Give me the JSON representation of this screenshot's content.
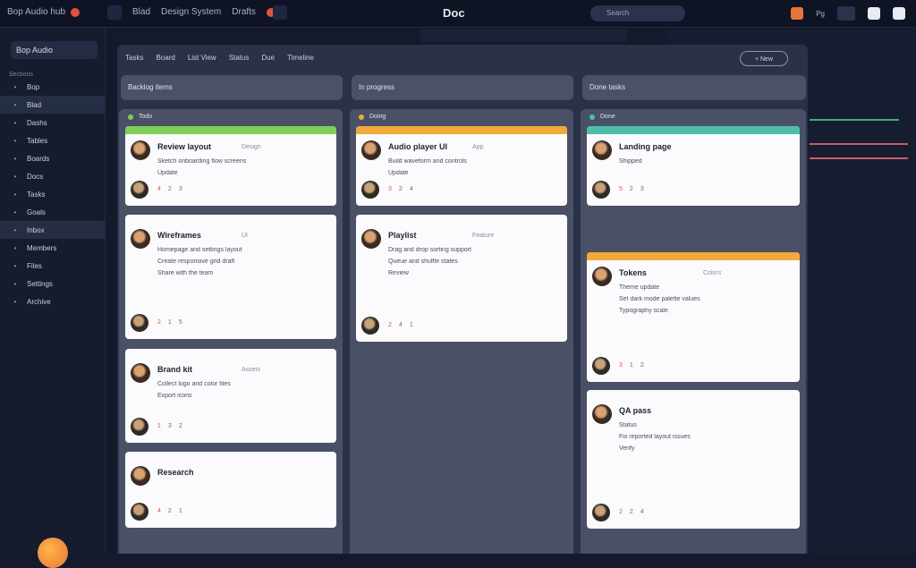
{
  "topbar": {
    "workspace": "Bop Audio hub",
    "crumbs": [
      "Blad",
      "Design System",
      "Drafts"
    ],
    "title": "Doc",
    "search_placeholder": "Search",
    "right_label": "Pg"
  },
  "sidebar": {
    "workspace_name": "Bop Audio",
    "section_label": "Sections",
    "items": [
      {
        "label": "Bop"
      },
      {
        "label": "Blad"
      },
      {
        "label": "Dashs"
      },
      {
        "label": "Tables"
      },
      {
        "label": "Boards"
      },
      {
        "label": "Docs"
      },
      {
        "label": "Tasks"
      },
      {
        "label": "Goals"
      },
      {
        "label": "Inbox"
      },
      {
        "label": "Members"
      },
      {
        "label": "Files"
      },
      {
        "label": "Settings"
      },
      {
        "label": "Archive"
      }
    ]
  },
  "board": {
    "header_items": [
      "Tasks",
      "Board",
      "List View",
      "Status",
      "Due",
      "Timeline"
    ],
    "button_label": "+ New",
    "columns": [
      {
        "head": "Backlog items",
        "title": "Todo",
        "color": "#7ccf5a",
        "cards": [
          {
            "name": "Review layout",
            "sub": "Design",
            "lines": [
              "Sketch onboarding flow screens",
              "Update"
            ],
            "foot": [
              "4",
              "2",
              "3"
            ]
          },
          {
            "name": "Wireframes",
            "sub": "UI",
            "lines": [
              "Homepage and settings layout",
              "Create responsive grid draft",
              "Share with the team"
            ],
            "foot": [
              "2",
              "1",
              "5"
            ]
          },
          {
            "name": "Brand kit",
            "sub": "Assets",
            "lines": [
              "Collect logo and color files",
              "Export icons"
            ],
            "foot": [
              "1",
              "3",
              "2"
            ]
          },
          {
            "name": "Research",
            "sub": "",
            "lines": [],
            "foot": [
              "4",
              "2",
              "1"
            ]
          }
        ]
      },
      {
        "head": "In progress",
        "title": "Doing",
        "color": "#f2a93b",
        "cards": [
          {
            "name": "Audio player UI",
            "sub": "App",
            "lines": [
              "Build waveform and controls",
              "Update"
            ],
            "foot": [
              "3",
              "2",
              "4"
            ]
          },
          {
            "name": "Playlist",
            "sub": "Feature",
            "lines": [
              "Drag and drop sorting support",
              "Queue and shuffle states",
              "Review"
            ],
            "foot": [
              "2",
              "4",
              "1"
            ]
          }
        ]
      },
      {
        "head": "Done tasks",
        "title": "Done",
        "color": "#4dbfa8",
        "cards": [
          {
            "name": "Landing page",
            "sub": "",
            "lines": [
              "Shipped"
            ],
            "foot": [
              "5",
              "2",
              "3"
            ]
          },
          {
            "name": "Tokens",
            "sub": "Colors",
            "lines": [
              "Theme update",
              "Set dark mode palette values",
              "Typography scale"
            ],
            "foot": [
              "3",
              "1",
              "2"
            ]
          },
          {
            "name": "QA pass",
            "sub": "",
            "lines": [
              "Status",
              "Fix reported layout issues",
              "Verify"
            ],
            "foot": [
              "2",
              "2",
              "4"
            ]
          }
        ]
      }
    ]
  }
}
